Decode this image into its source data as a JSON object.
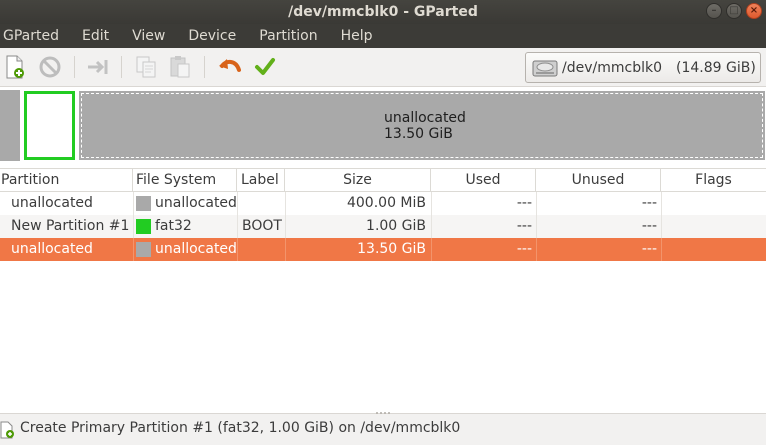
{
  "window": {
    "title": "/dev/mmcblk0 - GParted",
    "buttons": [
      "minimize",
      "maximize",
      "close"
    ]
  },
  "menubar": {
    "items": [
      "GParted",
      "Edit",
      "View",
      "Device",
      "Partition",
      "Help"
    ]
  },
  "toolbar": {
    "buttons": [
      {
        "name": "new-partition",
        "icon": "new-document-plus-icon",
        "enabled": true
      },
      {
        "name": "delete",
        "icon": "no-entry-icon",
        "enabled": false
      },
      {
        "name": "resize-move",
        "icon": "arrow-to-bar-icon",
        "enabled": false
      },
      {
        "name": "copy",
        "icon": "copy-icon",
        "enabled": false
      },
      {
        "name": "paste",
        "icon": "paste-icon",
        "enabled": false
      },
      {
        "name": "undo",
        "icon": "undo-arrow-icon",
        "enabled": true
      },
      {
        "name": "apply",
        "icon": "checkmark-icon",
        "enabled": true
      }
    ],
    "device": {
      "name": "/dev/mmcblk0",
      "size": "(14.89 GiB)",
      "icon": "hard-disk-icon"
    }
  },
  "graphic": {
    "selected_label": "unallocated",
    "selected_size": "13.50 GiB",
    "colors": {
      "unallocated": "#a9a9a9",
      "fat32": "#22cc22"
    }
  },
  "table": {
    "columns": [
      "Partition",
      "File System",
      "Label",
      "Size",
      "Used",
      "Unused",
      "Flags"
    ],
    "rows": [
      {
        "partition": "unallocated",
        "fs": "unallocated",
        "fs_color": "#a9a9a9",
        "label": "",
        "size": "400.00 MiB",
        "used": "---",
        "unused": "---",
        "flags": ""
      },
      {
        "partition": "New Partition #1",
        "fs": "fat32",
        "fs_color": "#22cc22",
        "label": "BOOT",
        "size": "1.00 GiB",
        "used": "---",
        "unused": "---",
        "flags": ""
      },
      {
        "partition": "unallocated",
        "fs": "unallocated",
        "fs_color": "#a9a9a9",
        "label": "",
        "size": "13.50 GiB",
        "used": "---",
        "unused": "---",
        "flags": ""
      }
    ],
    "selected_row_color": "#f07746"
  },
  "status": {
    "operation": "Create Primary Partition #1 (fat32, 1.00 GiB) on /dev/mmcblk0",
    "icon": "new-document-plus-icon"
  }
}
